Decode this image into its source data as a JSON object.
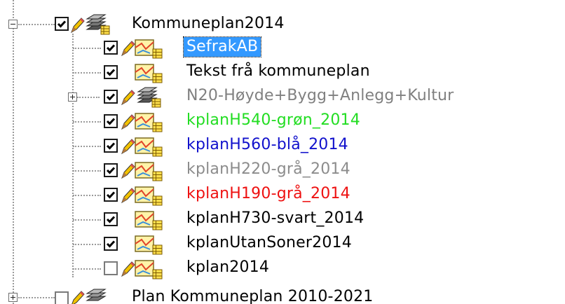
{
  "tree": {
    "root": {
      "label": "Kommuneplan2014",
      "checked": true,
      "expanded": true,
      "color": "#000000",
      "children": [
        {
          "label": "SefrakAB",
          "checked": true,
          "editable": true,
          "selected": true,
          "color": "#000000"
        },
        {
          "label": "Tekst frå kommuneplan",
          "checked": true,
          "editable": false,
          "color": "#000000"
        },
        {
          "label": "N20-Høyde+Bygg+Anlegg+Kultur",
          "checked": true,
          "editable": true,
          "group": true,
          "expanded": false,
          "color": "#808080"
        },
        {
          "label": "kplanH540-grøn_2014",
          "checked": true,
          "editable": true,
          "color": "#22dd22"
        },
        {
          "label": "kplanH560-blå_2014",
          "checked": true,
          "editable": true,
          "color": "#1111cc"
        },
        {
          "label": "kplanH220-grå_2014",
          "checked": true,
          "editable": true,
          "color": "#8c8c8c"
        },
        {
          "label": "kplanH190-grå_2014",
          "checked": true,
          "editable": true,
          "color": "#ee1111"
        },
        {
          "label": "kplanH730-svart_2014",
          "checked": true,
          "editable": false,
          "color": "#000000"
        },
        {
          "label": "kplanUtanSoner2014",
          "checked": true,
          "editable": false,
          "color": "#000000"
        },
        {
          "label": "kplan2014",
          "checked": false,
          "editable": true,
          "color": "#000000"
        }
      ]
    },
    "next": {
      "label": "Plan Kommuneplan 2010-2021",
      "checked": false,
      "expanded": false,
      "color": "#000000"
    }
  },
  "icons": {
    "group_layer": "stacked-layers-icon",
    "feature_layer": "map-layer-icon",
    "edit_pencil": "pencil-icon",
    "attribute_table": "table-icon"
  }
}
